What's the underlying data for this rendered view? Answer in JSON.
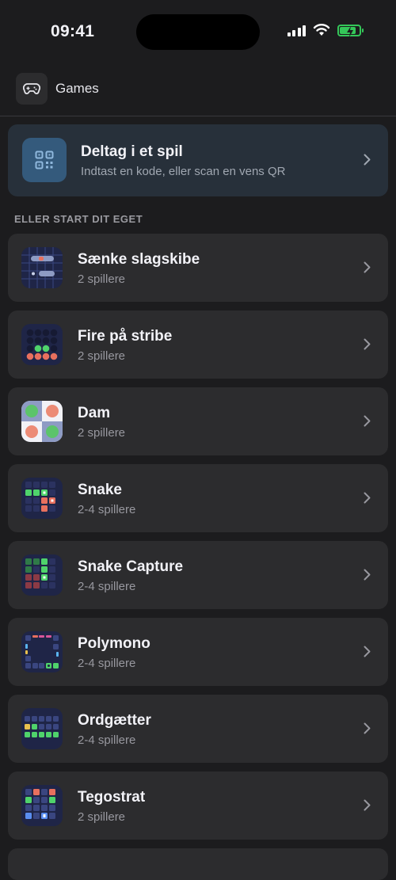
{
  "status_bar": {
    "time": "09:41",
    "battery_level": 0.85,
    "icons": [
      "signal-icon",
      "wifi-icon",
      "battery-charging-icon"
    ]
  },
  "header": {
    "icon": "gamepad-icon",
    "title": "Games"
  },
  "join": {
    "icon": "qr-code-icon",
    "title": "Deltag i et spil",
    "subtitle": "Indtast en kode, eller scan en vens QR"
  },
  "section": {
    "title": "ELLER START DIT EGET"
  },
  "games": [
    {
      "title": "Sænke slagskibe",
      "subtitle": "2 spillere",
      "icon": "battleship-icon"
    },
    {
      "title": "Fire på stribe",
      "subtitle": "2 spillere",
      "icon": "connect-four-icon"
    },
    {
      "title": "Dam",
      "subtitle": "2 spillere",
      "icon": "checkers-icon"
    },
    {
      "title": "Snake",
      "subtitle": "2-4 spillere",
      "icon": "snake-icon"
    },
    {
      "title": "Snake Capture",
      "subtitle": "2-4 spillere",
      "icon": "snake-capture-icon"
    },
    {
      "title": "Polymono",
      "subtitle": "2-4 spillere",
      "icon": "polymono-icon"
    },
    {
      "title": "Ordgætter",
      "subtitle": "2-4 spillere",
      "icon": "word-guess-icon"
    },
    {
      "title": "Tegostrat",
      "subtitle": "2 spillere",
      "icon": "tegostrat-icon"
    }
  ],
  "colors": {
    "background": "#1c1c1e",
    "card": "#2c2c2e",
    "join_card": "#27303a",
    "join_icon": "#345a7c",
    "battery": "#34c759"
  }
}
